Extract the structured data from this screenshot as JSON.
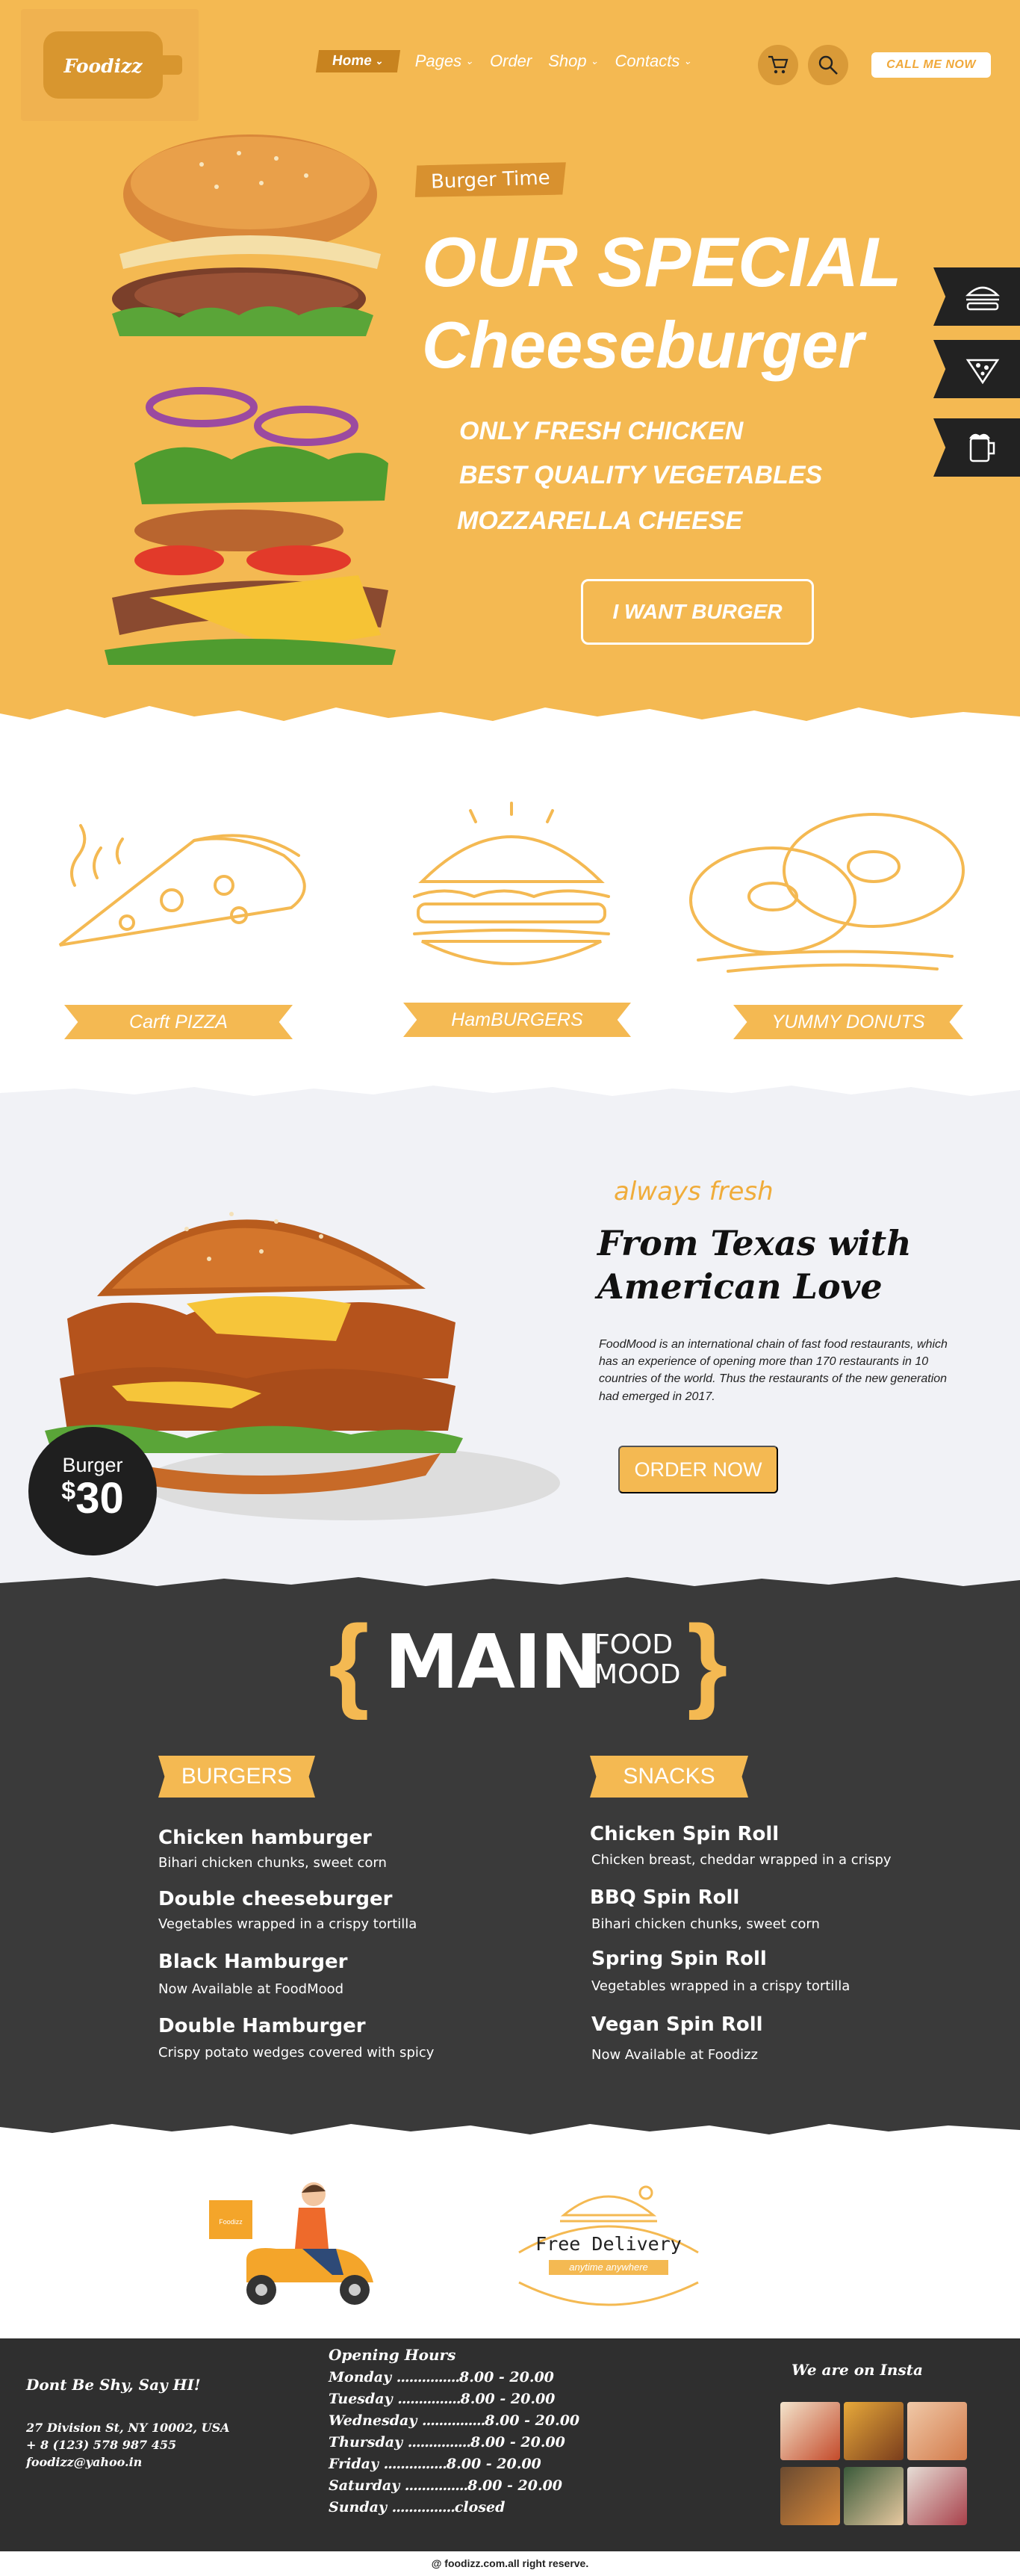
{
  "header": {
    "logo_text": "Foodizz",
    "nav": [
      {
        "label": "Home",
        "has_dropdown": true,
        "active": true
      },
      {
        "label": "Pages",
        "has_dropdown": true
      },
      {
        "label": "Order",
        "has_dropdown": false
      },
      {
        "label": "Shop",
        "has_dropdown": true
      },
      {
        "label": "Contacts",
        "has_dropdown": true
      }
    ],
    "call_button": "CALL ME NOW",
    "icons": [
      "cart-icon",
      "search-icon"
    ]
  },
  "hero": {
    "tag": "Burger Time",
    "title_line1": "OUR SPECIAL",
    "title_line2": "Cheeseburger",
    "features": [
      "ONLY FRESH CHICKEN",
      "BEST QUALITY VEGETABLES",
      "MOZZARELLA CHEESE"
    ],
    "cta": "I WANT BURGER",
    "side_tabs": [
      "burger-icon",
      "pizza-icon",
      "beer-icon"
    ]
  },
  "categories": [
    {
      "label": "Carft PIZZA",
      "icon": "pizza-sketch-icon"
    },
    {
      "label": "HamBURGERS",
      "icon": "burger-sketch-icon"
    },
    {
      "label": "YUMMY DONUTS",
      "icon": "donuts-sketch-icon"
    }
  ],
  "about": {
    "kicker": "always fresh",
    "title": "From Texas with American Love",
    "paragraph": "FoodMood is an international chain of fast food restaurants, which has an experience of opening more than 170 restaurants in 10 countries of the world. Thus the restaurants of the new generation had emerged in 2017.",
    "button": "ORDER NOW",
    "badge_label": "Burger",
    "badge_currency": "$",
    "badge_price": "30"
  },
  "menu": {
    "heading_main": "MAIN",
    "heading_sub1": "FOOD",
    "heading_sub2": "MOOD",
    "burgers_title": "BURGERS",
    "burgers": [
      {
        "name": "Chicken hamburger",
        "desc": "Bihari chicken chunks, sweet corn"
      },
      {
        "name": "Double cheeseburger",
        "desc": "Vegetables wrapped in a crispy tortilla"
      },
      {
        "name": "Black Hamburger",
        "desc": "Now Available at FoodMood"
      },
      {
        "name": "Double Hamburger",
        "desc": "Crispy potato wedges covered with spicy"
      }
    ],
    "snacks_title": "SNACKS",
    "snacks": [
      {
        "name": "Chicken Spin Roll",
        "desc": "Chicken breast, cheddar wrapped in a crispy"
      },
      {
        "name": "BBQ Spin Roll",
        "desc": "Bihari chicken chunks, sweet corn"
      },
      {
        "name": "Spring Spin Roll",
        "desc": "Vegetables wrapped in a crispy tortilla"
      },
      {
        "name": "Vegan Spin Roll",
        "desc": "Now Available at Foodizz"
      }
    ]
  },
  "delivery": {
    "box_label": "Foodizz",
    "title": "Free Delivery",
    "subtitle": "anytime anywhere"
  },
  "footer": {
    "tagline": "Dont Be Shy, Say HI!",
    "address": "27 Division St, NY 10002, USA",
    "phone": "+ 8 (123) 578 987 455",
    "email": "foodizz@yahoo.in",
    "hours_title": "Opening Hours",
    "hours": [
      {
        "day": "Monday",
        "time": "8.00 - 20.00"
      },
      {
        "day": "Tuesday",
        "time": "8.00 - 20.00"
      },
      {
        "day": "Wednesday",
        "time": "8.00 - 20.00"
      },
      {
        "day": "Thursday",
        "time": "8.00 - 20.00"
      },
      {
        "day": "Friday",
        "time": "8.00 - 20.00"
      },
      {
        "day": "Saturday",
        "time": "8.00 - 20.00"
      },
      {
        "day": "Sunday",
        "time": "closed"
      }
    ],
    "insta_title": "We are on Insta",
    "copyright": "@ foodizz.com.all right reserve."
  },
  "colors": {
    "accent": "#f4b952",
    "accent_dark": "#d8912f",
    "dark": "#3a3a3a",
    "footer": "#2f2f2f"
  }
}
